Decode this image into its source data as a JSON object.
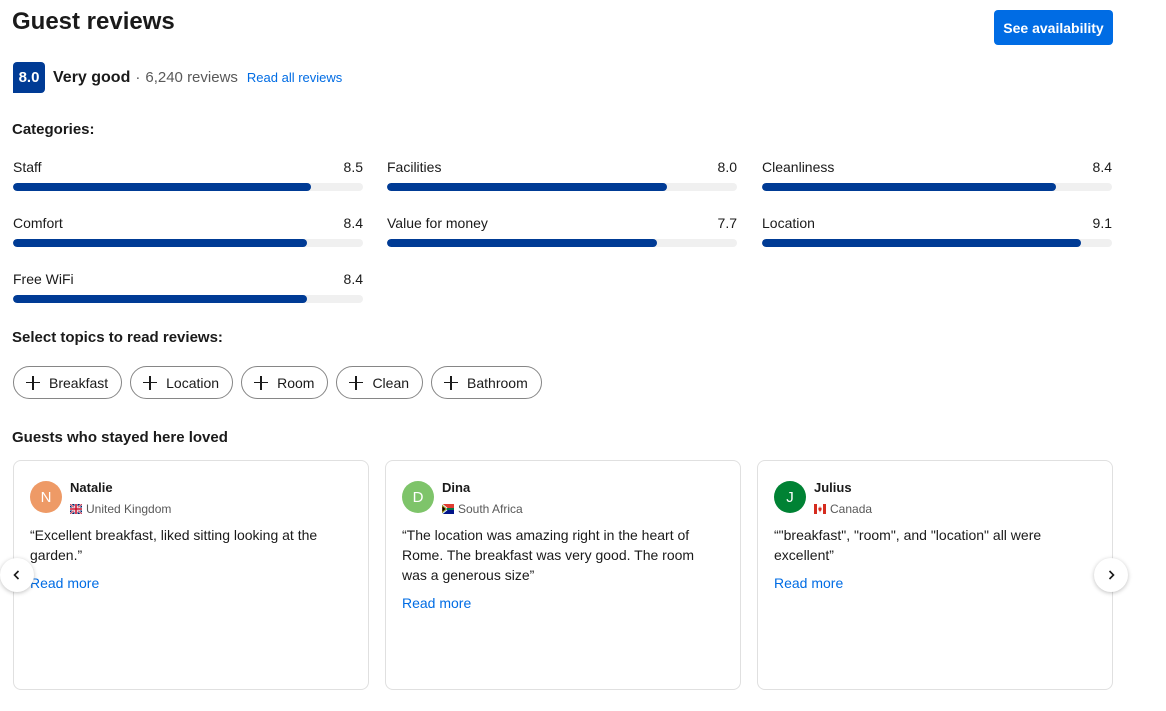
{
  "header": {
    "title": "Guest reviews",
    "availability_button": "See availability"
  },
  "score": {
    "value": "8.0",
    "label": "Very good",
    "separator": "·",
    "count": "6,240 reviews",
    "read_all": "Read all reviews"
  },
  "categories": {
    "heading": "Categories:",
    "items": [
      {
        "name": "Staff",
        "score": "8.5",
        "value": 8.5
      },
      {
        "name": "Facilities",
        "score": "8.0",
        "value": 8.0
      },
      {
        "name": "Cleanliness",
        "score": "8.4",
        "value": 8.4
      },
      {
        "name": "Comfort",
        "score": "8.4",
        "value": 8.4
      },
      {
        "name": "Value for money",
        "score": "7.7",
        "value": 7.7
      },
      {
        "name": "Location",
        "score": "9.1",
        "value": 9.1
      },
      {
        "name": "Free WiFi",
        "score": "8.4",
        "value": 8.4
      }
    ]
  },
  "topics": {
    "heading": "Select topics to read reviews:",
    "chips": [
      "Breakfast",
      "Location",
      "Room",
      "Clean",
      "Bathroom"
    ]
  },
  "loved": {
    "heading": "Guests who stayed here loved",
    "reviews": [
      {
        "initial": "N",
        "name": "Natalie",
        "country": "United Kingdom",
        "avatar_color": "#ee9a66",
        "flag": "uk-flag-icon",
        "text": "“Excellent breakfast, liked sitting looking at the garden.”",
        "read_more": "Read more"
      },
      {
        "initial": "D",
        "name": "Dina",
        "country": "South Africa",
        "avatar_color": "#7ec46a",
        "flag": "south-africa-flag-icon",
        "text": "“The location was amazing right in the heart of Rome. The breakfast was very good. The room was a generous size”",
        "read_more": "Read more"
      },
      {
        "initial": "J",
        "name": "Julius",
        "country": "Canada",
        "avatar_color": "#008234",
        "flag": "canada-flag-icon",
        "text": "“\"breakfast\", \"room\", and \"location\" all were excellent”",
        "read_more": "Read more"
      }
    ]
  },
  "colors": {
    "accent": "#006ce4",
    "brand": "#003b95",
    "bar_track": "#f0f0f0"
  },
  "icons": {
    "prev": "chevron-left-icon",
    "next": "chevron-right-icon",
    "chip": "plus-icon"
  }
}
